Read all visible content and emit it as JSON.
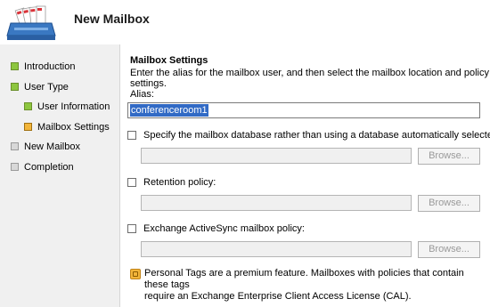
{
  "header": {
    "title": "New Mailbox",
    "icon": "mailbox-wizard-icon"
  },
  "sidebar": {
    "items": [
      {
        "label": "Introduction",
        "state": "complete"
      },
      {
        "label": "User Type",
        "state": "complete"
      },
      {
        "label": "User Information",
        "state": "complete"
      },
      {
        "label": "Mailbox Settings",
        "state": "current"
      },
      {
        "label": "New Mailbox",
        "state": "pending"
      },
      {
        "label": "Completion",
        "state": "pending"
      }
    ]
  },
  "main": {
    "section_title": "Mailbox Settings",
    "description": "Enter the alias for the mailbox user, and then select the mailbox location and policy settings.",
    "alias": {
      "label": "Alias:",
      "value": "conferenceroom1"
    },
    "database": {
      "label": "Specify the mailbox database rather than using a database automatically selected:",
      "checked": false,
      "browse": "Browse..."
    },
    "retention": {
      "label": "Retention policy:",
      "checked": false,
      "browse": "Browse..."
    },
    "activesync": {
      "label": "Exchange ActiveSync mailbox policy:",
      "checked": false,
      "browse": "Browse..."
    },
    "note": {
      "line1": "Personal Tags are a premium feature. Mailboxes with policies that contain these tags",
      "line2": "require an Exchange Enterprise Client Access License (CAL)."
    }
  },
  "colors": {
    "complete": "#8dc63f",
    "current": "#f2b53a",
    "pending": "#d8d8d8",
    "selection": "#316ac5"
  }
}
